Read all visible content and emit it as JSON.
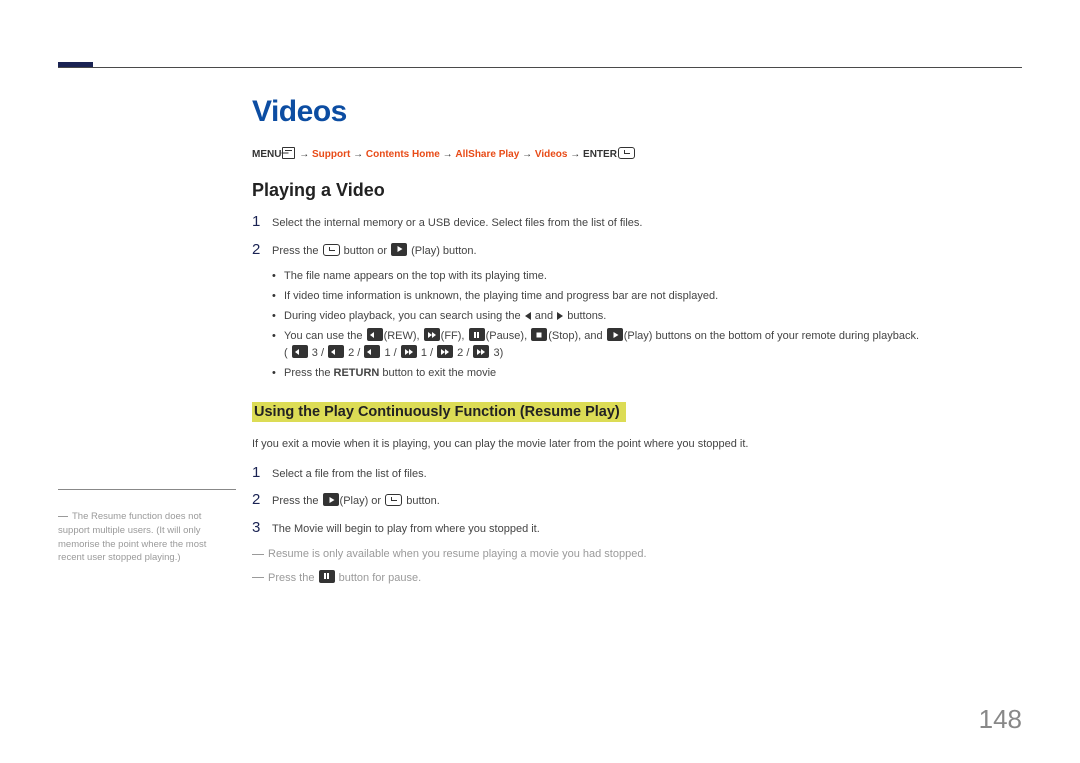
{
  "page_number": "148",
  "title": "Videos",
  "breadcrumb": {
    "menu": "MENU",
    "support": "Support",
    "contents_home": "Contents Home",
    "allshare_play": "AllShare Play",
    "videos": "Videos",
    "enter": "ENTER"
  },
  "section1": {
    "heading": "Playing a Video",
    "steps": [
      "Select the internal memory or a USB device. Select files from the list of files.",
      "Press the ⏎ button or ▶ (Play) button."
    ],
    "bullets": [
      "The file name appears on the top with its playing time.",
      "If video time information is unknown, the playing time and progress bar are not displayed.",
      "During video playback, you can search using the ◄ and ► buttons.",
      "You can use the ⏪(REW), ⏩(FF), ⏸(Pause), ⏹(Stop), and ▶(Play) buttons on the bottom of your remote during playback.",
      "( ⏪ 3 / ⏪ 2 / ⏪ 1 / ⏩ 1 / ⏩ 2 / ⏩ 3)",
      "Press the RETURN button to exit the movie"
    ]
  },
  "section2": {
    "heading": "Using the Play Continuously Function (Resume Play)",
    "intro": "If you exit a movie when it is playing, you can play the movie later from the point where you stopped it.",
    "steps": [
      "Select a file from the list of files.",
      "Press the ▶(Play) or ⏎ button.",
      "The Movie will begin to play from where you stopped it."
    ],
    "notes": [
      "Resume is only available when you resume playing a movie you had stopped.",
      "Press the ⏸ button for pause."
    ]
  },
  "side_note": "The Resume function does not support multiple users. (It will only memorise the point where the most recent user stopped playing.)"
}
